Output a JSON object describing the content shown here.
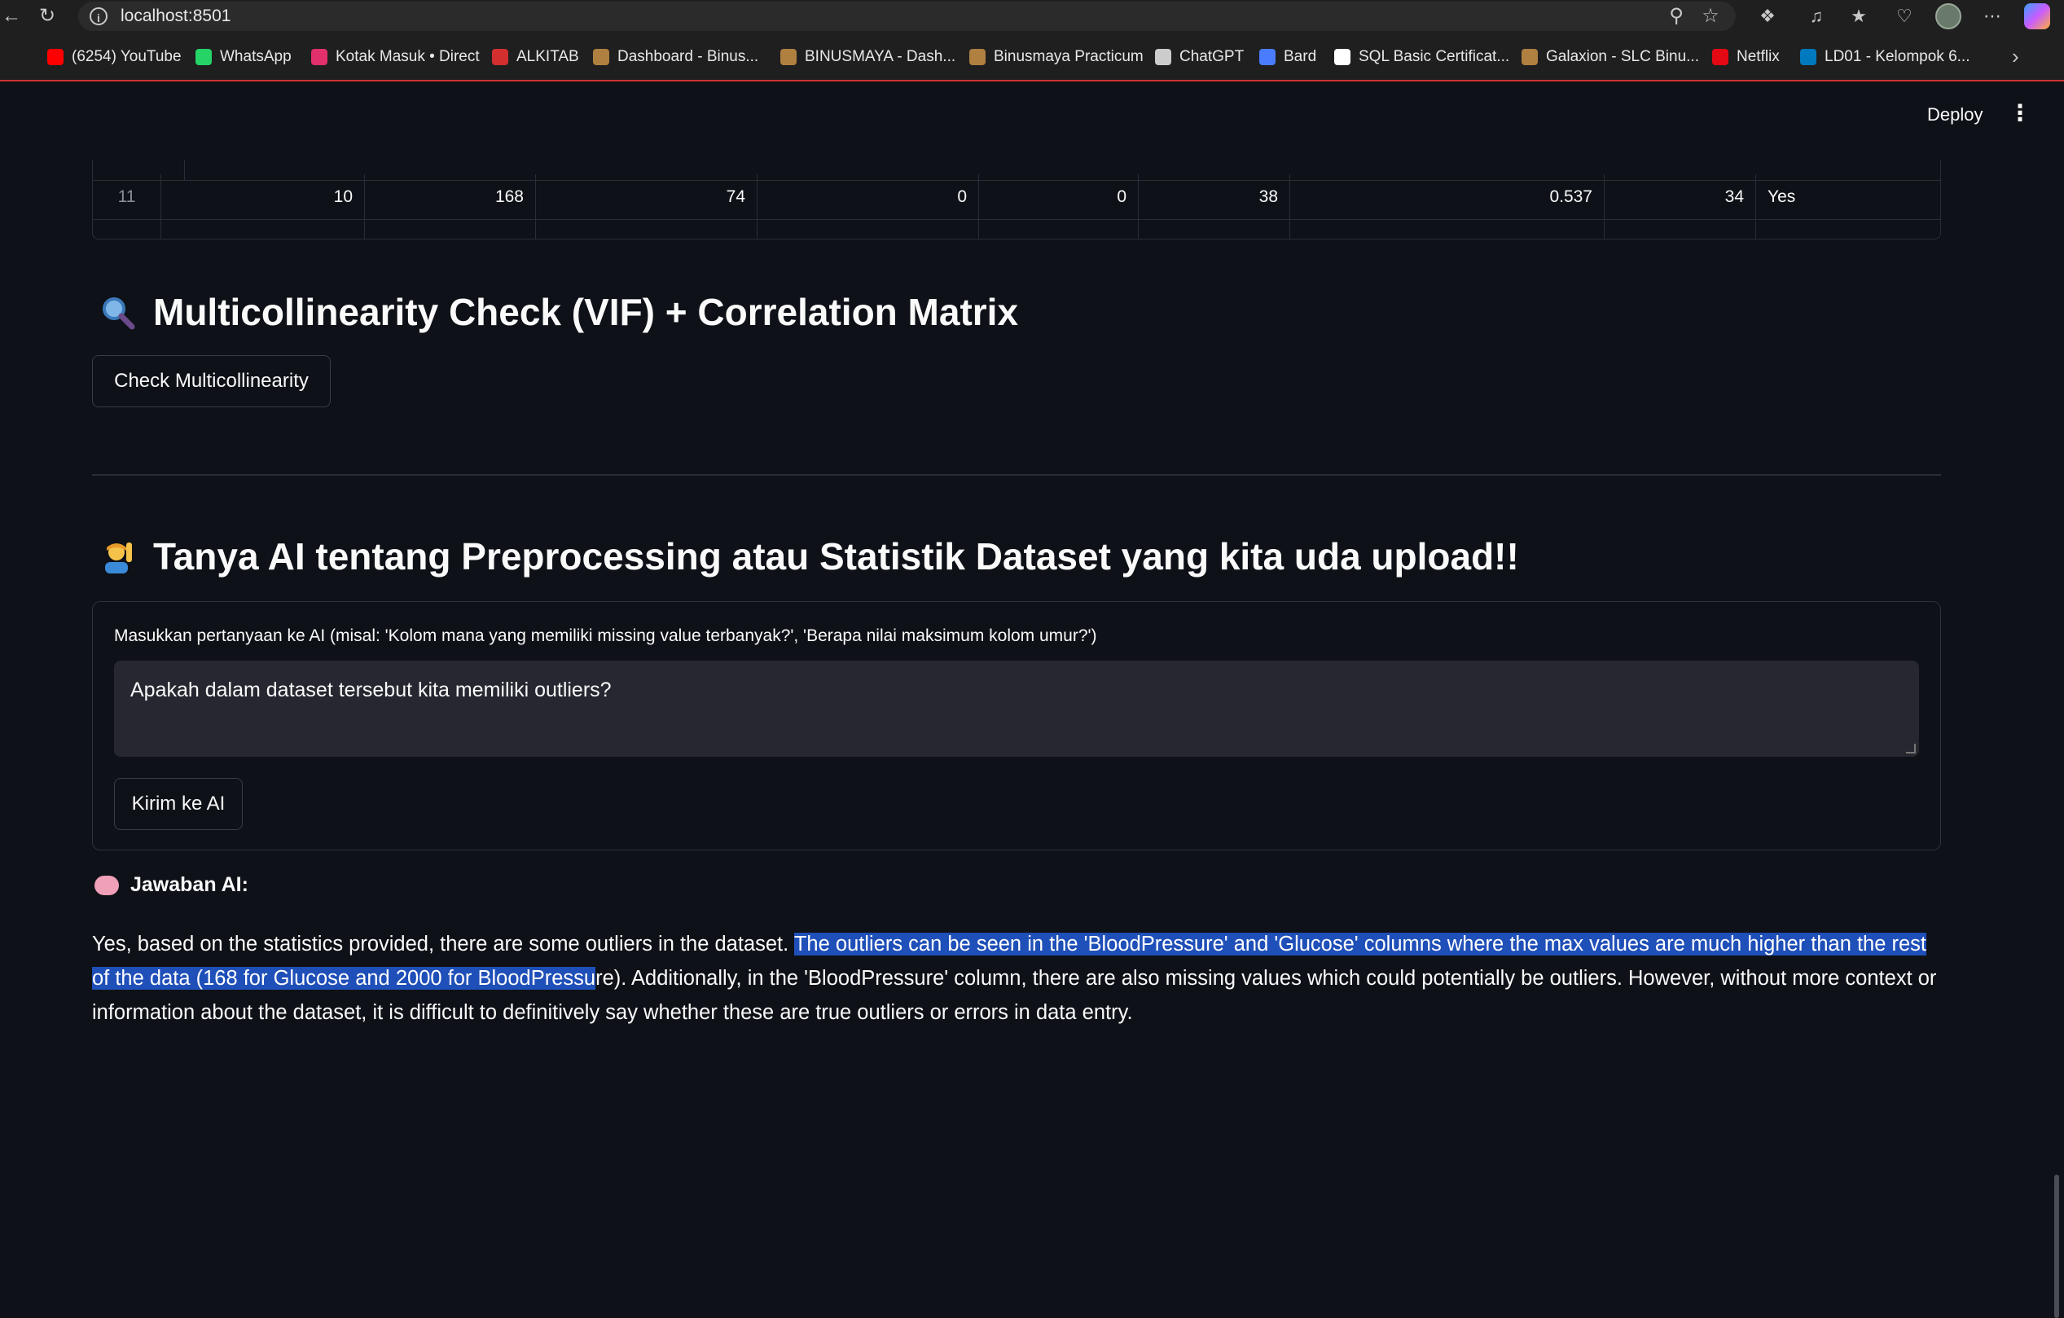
{
  "browser": {
    "url": "localhost:8501",
    "bookmarks": [
      {
        "label": "(6254) YouTube",
        "color": "#ff0000"
      },
      {
        "label": "WhatsApp",
        "color": "#25d366"
      },
      {
        "label": "Kotak Masuk • Direct",
        "color": "#e1306c"
      },
      {
        "label": "ALKITAB",
        "color": "#d32f2f"
      },
      {
        "label": "Dashboard - Binus...",
        "color": "#b08040"
      },
      {
        "label": "BINUSMAYA - Dash...",
        "color": "#b08040"
      },
      {
        "label": "Binusmaya Practicum",
        "color": "#b08040"
      },
      {
        "label": "ChatGPT",
        "color": "#cccccc"
      },
      {
        "label": "Bard",
        "color": "#4a7cff"
      },
      {
        "label": "SQL Basic Certificat...",
        "color": "#ffffff"
      },
      {
        "label": "Galaxion - SLC Binu...",
        "color": "#b08040"
      },
      {
        "label": "Netflix",
        "color": "#e50914"
      },
      {
        "label": "LD01 - Kelompok 6...",
        "color": "#0079bf"
      }
    ]
  },
  "header": {
    "deploy_label": "Deploy"
  },
  "table": {
    "row": {
      "index": "11",
      "cells": [
        "10",
        "168",
        "74",
        "0",
        "0",
        "38",
        "0.537",
        "34",
        "Yes"
      ]
    }
  },
  "multicollinearity": {
    "title": "Multicollinearity Check (VIF) + Correlation Matrix",
    "button_label": "Check Multicollinearity"
  },
  "ask_ai": {
    "title": "Tanya AI tentang Preprocessing atau Statistik Dataset yang kita uda upload!!",
    "input_label": "Masukkan pertanyaan ke AI (misal: 'Kolom mana yang memiliki missing value terbanyak?', 'Berapa nilai maksimum kolom umur?')",
    "input_value": "Apakah dalam dataset tersebut kita memiliki outliers?",
    "submit_label": "Kirim ke AI"
  },
  "answer": {
    "heading": "Jawaban AI:",
    "text_before": "Yes, based on the statistics provided, there are some outliers in the dataset. ",
    "text_highlighted": "The outliers can be seen in the 'BloodPressure' and 'Glucose' columns where the max values are much higher than the rest of the data (168 for Glucose and 2000 for BloodPressu",
    "text_after": "re). Additionally, in the 'BloodPressure' column, there are also missing values which could potentially be outliers. However, without more context or information about the dataset, it is difficult to definitively say whether these are true outliers or errors in data entry."
  },
  "colors": {
    "background": "#0e1117",
    "selection": "#1f4fb8",
    "input_bg": "#262730"
  }
}
